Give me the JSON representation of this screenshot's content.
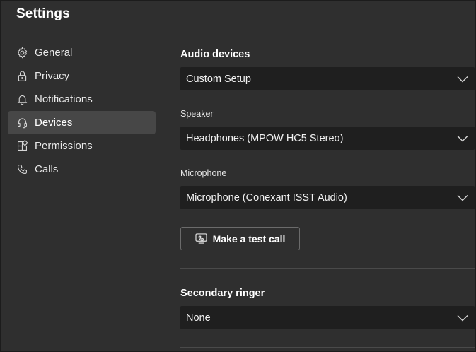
{
  "window": {
    "title": "Settings"
  },
  "sidebar": {
    "items": [
      {
        "label": "General",
        "icon": "gear-icon"
      },
      {
        "label": "Privacy",
        "icon": "lock-icon"
      },
      {
        "label": "Notifications",
        "icon": "bell-icon"
      },
      {
        "label": "Devices",
        "icon": "headset-icon",
        "active": true
      },
      {
        "label": "Permissions",
        "icon": "permissions-icon"
      },
      {
        "label": "Calls",
        "icon": "phone-icon"
      }
    ]
  },
  "main": {
    "audio_devices": {
      "heading": "Audio devices",
      "value": "Custom Setup"
    },
    "speaker": {
      "label": "Speaker",
      "value": "Headphones (MPOW HC5 Stereo)"
    },
    "microphone": {
      "label": "Microphone",
      "value": "Microphone (Conexant ISST Audio)"
    },
    "test_call": {
      "label": "Make a test call",
      "icon": "test-call-icon"
    },
    "secondary_ringer": {
      "heading": "Secondary ringer",
      "value": "None"
    }
  }
}
